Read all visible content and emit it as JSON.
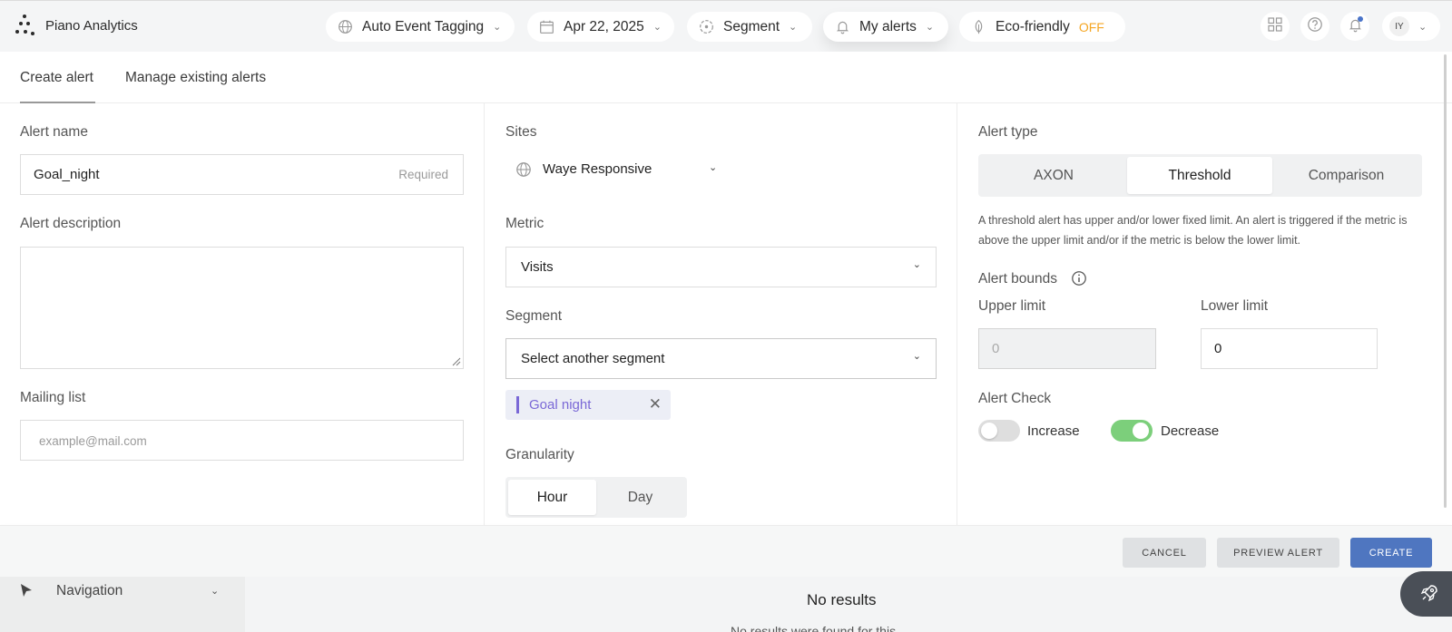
{
  "app": {
    "name": "Piano Analytics"
  },
  "topbar": {
    "event_tagging": "Auto Event Tagging",
    "date": "Apr 22, 2025",
    "segment": "Segment",
    "alerts": "My alerts",
    "eco_label": "Eco-friendly",
    "eco_state": "OFF",
    "user_initials": "IY"
  },
  "tabs": [
    {
      "label": "Create alert",
      "active": true
    },
    {
      "label": "Manage existing alerts",
      "active": false
    }
  ],
  "form": {
    "alert_name_label": "Alert name",
    "alert_name_value": "Goal_night",
    "alert_name_hint": "Required",
    "description_label": "Alert description",
    "description_value": "",
    "mailing_label": "Mailing list",
    "mailing_placeholder": "example@mail.com",
    "sites_label": "Sites",
    "site_value": "Waye Responsive",
    "metric_label": "Metric",
    "metric_value": "Visits",
    "segment_label": "Segment",
    "segment_placeholder": "Select another segment",
    "segment_tag": "Goal night",
    "granularity_label": "Granularity",
    "granularity_options": [
      "Hour",
      "Day"
    ],
    "granularity_selected": "Hour",
    "alert_type_label": "Alert type",
    "alert_types": [
      "AXON",
      "Threshold",
      "Comparison"
    ],
    "alert_type_selected": "Threshold",
    "alert_type_description": "A threshold alert has upper and/or lower fixed limit. An alert is triggered if the metric is above the upper limit and/or if the metric is below the lower limit.",
    "bounds_label": "Alert bounds",
    "upper_label": "Upper limit",
    "upper_value": "0",
    "lower_label": "Lower limit",
    "lower_value": "0",
    "check_label": "Alert Check",
    "increase_label": "Increase",
    "increase_on": false,
    "decrease_label": "Decrease",
    "decrease_on": true
  },
  "footer": {
    "cancel": "CANCEL",
    "preview": "PREVIEW ALERT",
    "create": "CREATE"
  },
  "background": {
    "nav_label": "Navigation",
    "no_results_title": "No results",
    "no_results_sub": "No results were found for this"
  },
  "colors": {
    "accent": "#4f76c0",
    "segment_tag": "#7a68d6",
    "toggle_on": "#7ccf7b",
    "eco_off": "#f5a623"
  }
}
